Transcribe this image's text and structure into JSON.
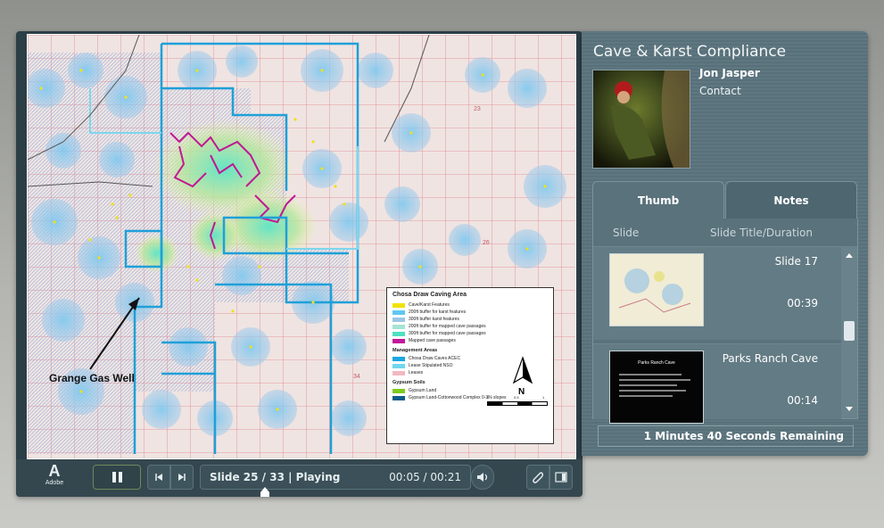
{
  "player": {
    "slide": {
      "callout": "Grange Gas Well",
      "legend": {
        "title": "Chosa Draw Caving Area",
        "items": [
          {
            "label": "Cave/Karst Features",
            "color": "#f2e100"
          },
          {
            "label": "200ft buffer for karst features",
            "color": "#5fc7f2"
          },
          {
            "label": "300ft buffer karst features",
            "color": "#9ac6e6"
          },
          {
            "label": "200ft buffer for mapped cave passages",
            "color": "#a6e3d6"
          },
          {
            "label": "300ft buffer for mapped cave passages",
            "color": "#4ee0c2"
          },
          {
            "label": "Mapped cave passages",
            "color": "#c2189a"
          }
        ],
        "management_title": "Management Areas",
        "management_items": [
          {
            "label": "Chosa Draw Caves ACEC",
            "color": "#1aa6e0"
          },
          {
            "label": "Lease Stipulated NSO",
            "color": "#6fd7f0"
          },
          {
            "label": "Leases",
            "color": "#f2b8c0"
          }
        ],
        "soils_title": "Gypsum Soils",
        "soils_items": [
          {
            "label": "Gypsum Land",
            "color": "#7ccc1c"
          },
          {
            "label": "Gypsum Land-Cottonwood Complex 0-3% slopes",
            "color": "#0c5c8a"
          }
        ],
        "north": "N",
        "scale_labels": [
          "0",
          "0.5",
          "1"
        ]
      }
    },
    "controls": {
      "brand": "Adobe",
      "status": "Slide 25 / 33 | Playing",
      "time": "00:05 / 00:21",
      "slide_progress": 0.24
    }
  },
  "panel": {
    "title": "Cave & Karst Compliance",
    "presenter_name": "Jon Jasper",
    "presenter_role": "Contact",
    "tabs": [
      {
        "label": "Thumb",
        "active": true
      },
      {
        "label": "Notes",
        "active": false
      }
    ],
    "columns": [
      "Slide",
      "Slide Title/Duration"
    ],
    "items": [
      {
        "title": "Slide 17",
        "duration": "00:39"
      },
      {
        "title": "Parks Ranch Cave",
        "duration": "00:14",
        "thumb_title": "Parks Ranch Cave"
      }
    ],
    "remaining": "1 Minutes 40 Seconds Remaining"
  }
}
